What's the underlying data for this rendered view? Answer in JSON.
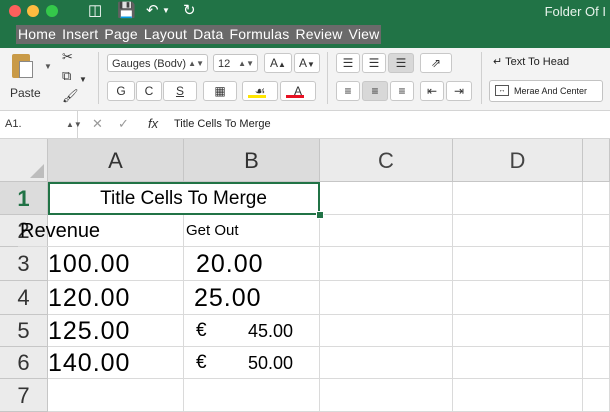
{
  "window": {
    "title": "Folder Of I",
    "toolbar_icons": [
      "sidebar-icon",
      "save-icon",
      "undo-icon",
      "redo-icon"
    ]
  },
  "menu": [
    "Home",
    "Insert",
    "Page",
    "Layout",
    "Data",
    "Formulas",
    "Review",
    "View"
  ],
  "ribbon": {
    "paste_label": "Paste",
    "font_name": "Gauges (Bodv)",
    "font_size": "12",
    "bold": "G",
    "italic": "C",
    "underline": "S",
    "wrap_text_label": "Text To Head",
    "merge_label": "Merae And Center",
    "fill_color": "#ffe500",
    "font_color": "#e81123"
  },
  "formula_bar": {
    "name_box": "A1.",
    "fx": "fx",
    "content": "Title Cells To Merge"
  },
  "sheet": {
    "columns": [
      "A",
      "B",
      "C",
      "D"
    ],
    "rows": [
      "1",
      "2",
      "3",
      "4",
      "5",
      "6",
      "7"
    ],
    "title_cell": "Title Cells To Merge",
    "cells": [
      {
        "row": 2,
        "a": "Revenue",
        "b": "Get Out"
      },
      {
        "row": 3,
        "a": "100.00",
        "b": "20.00"
      },
      {
        "row": 4,
        "a": "120.00",
        "b": "25.00"
      },
      {
        "row": 5,
        "a": "125.00",
        "b_currency": "€",
        "b": "45.00"
      },
      {
        "row": 6,
        "a": "140.00",
        "b_currency": "€",
        "b": "50.00"
      }
    ]
  }
}
